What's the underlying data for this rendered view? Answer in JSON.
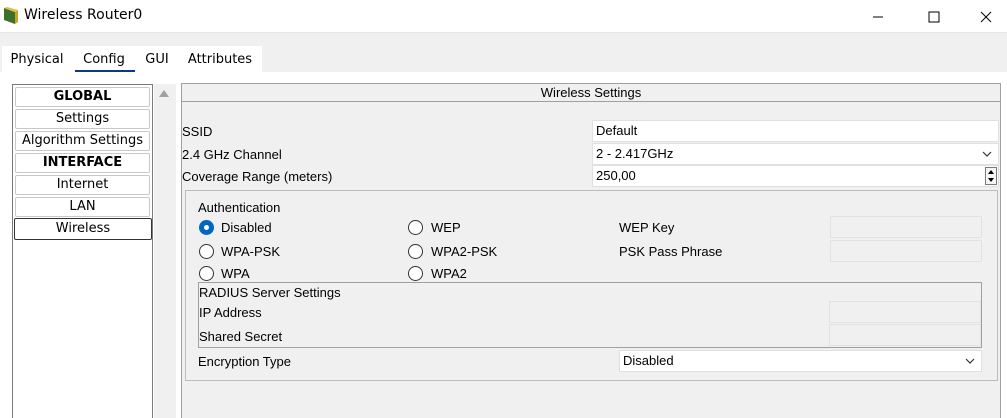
{
  "window": {
    "title": "Wireless Router0"
  },
  "tabs": [
    {
      "label": "Physical"
    },
    {
      "label": "Config"
    },
    {
      "label": "GUI"
    },
    {
      "label": "Attributes"
    }
  ],
  "nav": {
    "items": [
      {
        "label": "GLOBAL"
      },
      {
        "label": "Settings"
      },
      {
        "label": "Algorithm Settings"
      },
      {
        "label": "INTERFACE"
      },
      {
        "label": "Internet"
      },
      {
        "label": "LAN"
      },
      {
        "label": "Wireless"
      }
    ]
  },
  "panel": {
    "title": "Wireless Settings",
    "ssid": {
      "label": "SSID",
      "value": "Default"
    },
    "channel": {
      "label": "2.4 GHz Channel",
      "value": "2 - 2.417GHz"
    },
    "coverage": {
      "label": "Coverage Range (meters)",
      "value": "250,00"
    },
    "auth": {
      "title": "Authentication",
      "options": [
        {
          "label": "Disabled",
          "checked": true
        },
        {
          "label": "WEP",
          "checked": false
        },
        {
          "label": "WPA-PSK",
          "checked": false
        },
        {
          "label": "WPA2-PSK",
          "checked": false
        },
        {
          "label": "WPA",
          "checked": false
        },
        {
          "label": "WPA2",
          "checked": false
        }
      ],
      "wep_key_label": "WEP Key",
      "psk_label": "PSK Pass Phrase"
    },
    "radius": {
      "title": "RADIUS Server Settings",
      "ip_label": "IP Address",
      "secret_label": "Shared Secret"
    },
    "encryption": {
      "label": "Encryption Type",
      "value": "Disabled"
    }
  },
  "colors": {
    "accent": "#0067c0",
    "tab_underline": "#0a3a82"
  }
}
